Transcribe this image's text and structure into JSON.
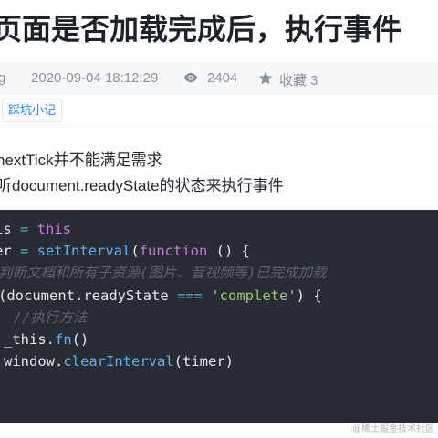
{
  "article": {
    "title": "页面是否加载完成后，执行事件",
    "author": "g",
    "date": "2020-09-04 18:12:29",
    "views": "2404",
    "favorites": "收藏 3",
    "tag": "踩坑小记"
  },
  "body": {
    "paragraph1": "nextTick并不能满足需求",
    "paragraph2": "听document.readyState的状态来执行事件"
  },
  "code": {
    "line1": {
      "a": "is ",
      "b": "=",
      "c": " this"
    },
    "line2": {
      "a": "er ",
      "b": "=",
      "c": " setInterval",
      "d": "(",
      "e": "function",
      "f": " () {"
    },
    "line3": "判断文档和所有子资源(图片、音视频等)已完成加载",
    "line4": {
      "a": "(document.",
      "b": "readyState",
      "c": " === ",
      "d": "'complete'",
      "e": ") {"
    },
    "line5": "  //执行方法",
    "line6": {
      "a": "_this.",
      "b": "fn",
      "c": "()"
    },
    "line7": {
      "a": "window.",
      "b": "clearInterval",
      "c": "(timer)"
    }
  },
  "watermark": "@稀土掘金技术社区",
  "icons": {
    "views": "eye-icon",
    "favorites": "star-icon"
  },
  "colors": {
    "accent": "#1e80ff",
    "code_bg": "#282c34",
    "keyword": "#c678dd",
    "function": "#61afef",
    "string": "#98c379"
  }
}
